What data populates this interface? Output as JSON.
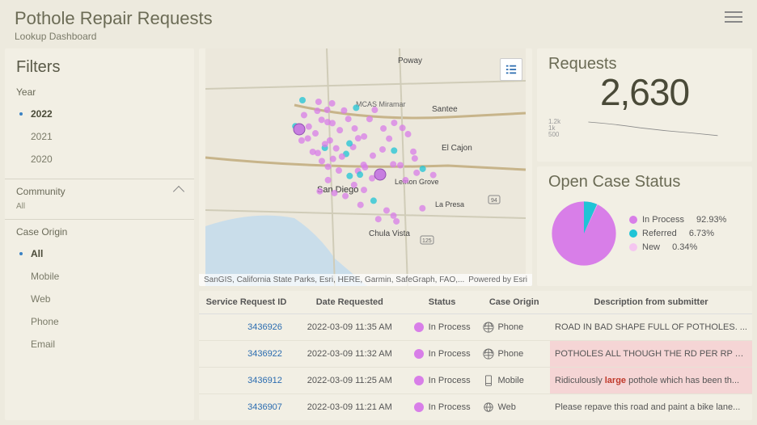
{
  "header": {
    "title": "Pothole Repair Requests",
    "subtitle": "Lookup Dashboard"
  },
  "sidebar": {
    "title": "Filters",
    "year": {
      "label": "Year",
      "options": [
        "2022",
        "2021",
        "2020"
      ],
      "selected": "2022"
    },
    "community": {
      "label": "Community",
      "sub": "All"
    },
    "origin": {
      "label": "Case Origin",
      "options": [
        "All",
        "Mobile",
        "Web",
        "Phone",
        "Email"
      ],
      "selected": "All"
    }
  },
  "map": {
    "labels": [
      "Poway",
      "Santee",
      "MCAS Miramar",
      "El Cajon",
      "Lemon Grove",
      "La Presa",
      "San Diego",
      "Chula Vista"
    ],
    "attribution": "SanGIS, California State Parks, Esri, HERE, Garmin, SafeGraph, FAO,...",
    "powered": "Powered by Esri"
  },
  "requests": {
    "title": "Requests",
    "value": "2,630",
    "ticks": "1.2k\n1k\n500"
  },
  "status": {
    "title": "Open Case Status",
    "items": [
      {
        "label": "In Process",
        "pct": "92.93%",
        "color": "#d87ee8"
      },
      {
        "label": "Referred",
        "pct": "6.73%",
        "color": "#1fc4d6"
      },
      {
        "label": "New",
        "pct": "0.34%",
        "color": "#f5c6f0"
      }
    ]
  },
  "table": {
    "cols": [
      "Service Request ID",
      "Date Requested",
      "Status",
      "Case Origin",
      "Description from submitter"
    ],
    "rows": [
      {
        "id": "3436926",
        "date": "2022-03-09 11:35 AM",
        "status": "In Process",
        "origin": "Phone",
        "desc": "ROAD IN BAD SHAPE FULL OF POTHOLES. ..."
      },
      {
        "id": "3436922",
        "date": "2022-03-09 11:32 AM",
        "status": "In Process",
        "origin": "Phone",
        "desc": "POTHOLES ALL THOUGH THE RD PER RP TH...",
        "hl": true
      },
      {
        "id": "3436912",
        "date": "2022-03-09 11:25 AM",
        "status": "In Process",
        "origin": "Mobile",
        "desc_pre": "Ridiculously ",
        "desc_em": "large",
        "desc_post": " pothole which has been th...",
        "hl": true
      },
      {
        "id": "3436907",
        "date": "2022-03-09 11:21 AM",
        "status": "In Process",
        "origin": "Web",
        "desc": "Please repave this road and paint a bike lane..."
      }
    ]
  },
  "chart_data": [
    {
      "type": "line",
      "title": "Requests sparkline",
      "values": [
        1200,
        1000,
        900,
        850,
        820,
        800,
        780,
        760,
        740,
        720,
        710,
        700,
        690,
        680,
        670,
        660,
        650,
        640,
        630,
        620,
        610,
        600
      ]
    },
    {
      "type": "pie",
      "title": "Open Case Status",
      "series": [
        {
          "name": "In Process",
          "value": 92.93
        },
        {
          "name": "Referred",
          "value": 6.73
        },
        {
          "name": "New",
          "value": 0.34
        }
      ]
    }
  ]
}
